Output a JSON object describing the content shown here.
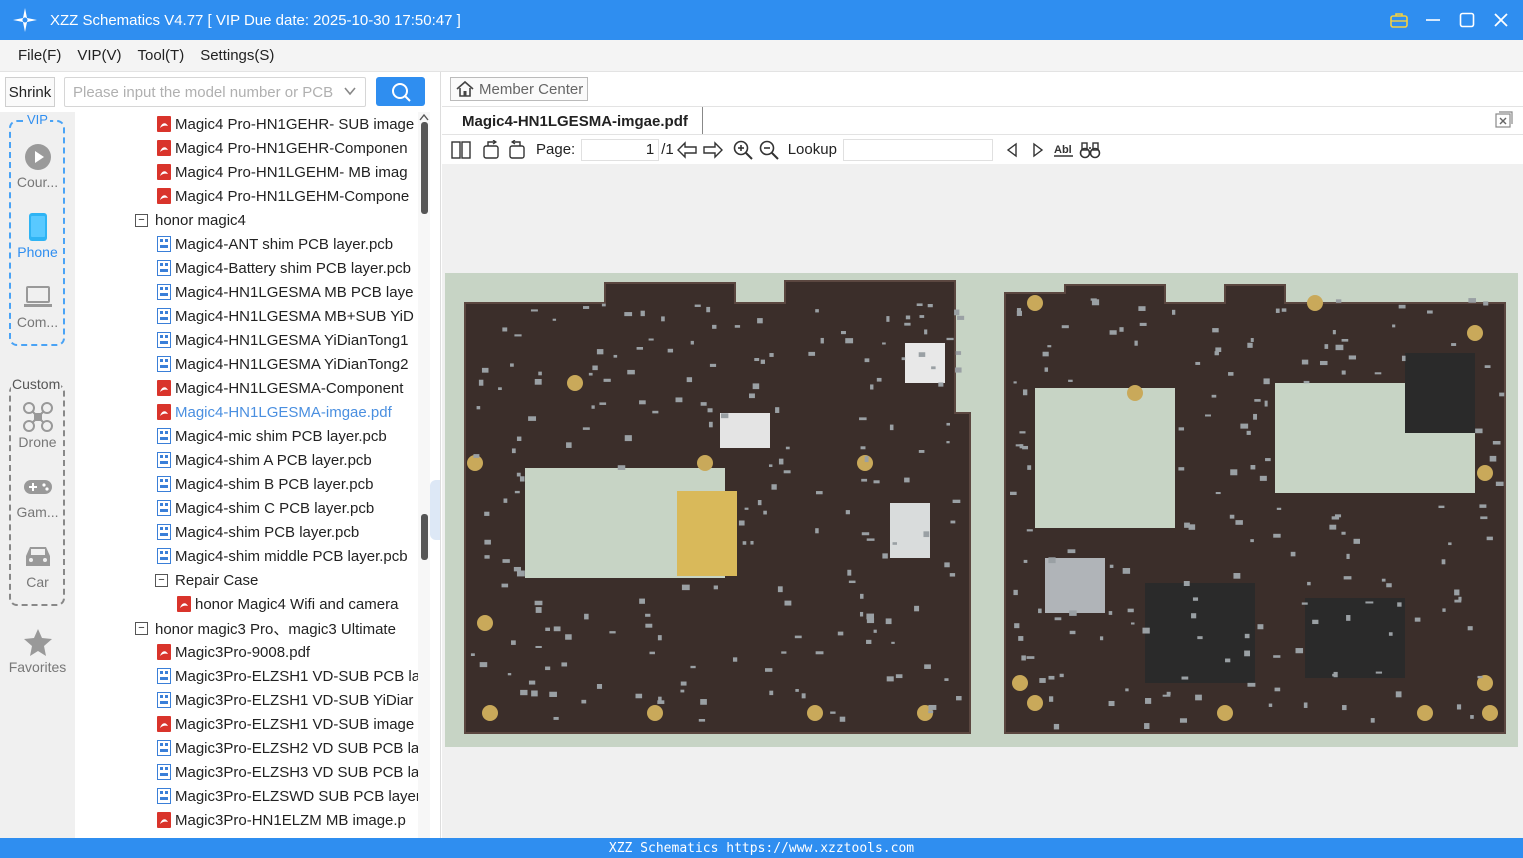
{
  "window": {
    "title": "XZZ Schematics V4.77 [ VIP Due date: 2025-10-30 17:50:47 ]"
  },
  "menu": [
    "File(F)",
    "VIP(V)",
    "Tool(T)",
    "Settings(S)"
  ],
  "search": {
    "shrink_label": "Shrink",
    "placeholder": "Please input the model number or PCB"
  },
  "categories": {
    "vip_label": "VIP",
    "custom_label": "Custom",
    "items": [
      {
        "label": "Cour...",
        "icon": "play-circle-icon"
      },
      {
        "label": "Phone",
        "icon": "phone-icon"
      },
      {
        "label": "Com...",
        "icon": "laptop-icon"
      },
      {
        "label": "Drone",
        "icon": "drone-icon"
      },
      {
        "label": "Gam...",
        "icon": "gamepad-icon"
      },
      {
        "label": "Car",
        "icon": "car-icon"
      },
      {
        "label": "Favorites",
        "icon": "star-icon"
      }
    ]
  },
  "tree": [
    {
      "label": "Magic4 Pro-HN1GEHR- SUB image",
      "type": "pdf"
    },
    {
      "label": "Magic4 Pro-HN1GEHR-Componen",
      "type": "pdf"
    },
    {
      "label": "Magic4 Pro-HN1LGEHM- MB imag",
      "type": "pdf"
    },
    {
      "label": "Magic4 Pro-HN1LGEHM-Compone",
      "type": "pdf"
    },
    {
      "label": "honor magic4",
      "type": "folder"
    },
    {
      "label": "Magic4-ANT shim PCB layer.pcb",
      "type": "pcb"
    },
    {
      "label": "Magic4-Battery shim PCB layer.pcb",
      "type": "pcb"
    },
    {
      "label": "Magic4-HN1LGESMA MB PCB laye",
      "type": "pcb"
    },
    {
      "label": "Magic4-HN1LGESMA MB+SUB YiD",
      "type": "pcb"
    },
    {
      "label": "Magic4-HN1LGESMA YiDianTong1",
      "type": "pcb"
    },
    {
      "label": "Magic4-HN1LGESMA YiDianTong2",
      "type": "pcb"
    },
    {
      "label": "Magic4-HN1LGESMA-Component",
      "type": "pdf"
    },
    {
      "label": "Magic4-HN1LGESMA-imgae.pdf",
      "type": "pdf"
    },
    {
      "label": "Magic4-mic shim PCB layer.pcb",
      "type": "pcb"
    },
    {
      "label": "Magic4-shim A PCB layer.pcb",
      "type": "pcb"
    },
    {
      "label": "Magic4-shim B PCB layer.pcb",
      "type": "pcb"
    },
    {
      "label": "Magic4-shim C PCB layer.pcb",
      "type": "pcb"
    },
    {
      "label": "Magic4-shim PCB layer.pcb",
      "type": "pcb"
    },
    {
      "label": "Magic4-shim middle PCB layer.pcb",
      "type": "pcb"
    },
    {
      "label": "Repair Case",
      "type": "folder"
    },
    {
      "label": "honor Magic4 Wifi and camera",
      "type": "pdf"
    },
    {
      "label": "honor magic3 Pro、magic3 Ultimate",
      "type": "folder"
    },
    {
      "label": "Magic3Pro-9008.pdf",
      "type": "pdf"
    },
    {
      "label": "Magic3Pro-ELZSH1 VD-SUB PCB la",
      "type": "pcb"
    },
    {
      "label": "Magic3Pro-ELZSH1 VD-SUB YiDiar",
      "type": "pcb"
    },
    {
      "label": "Magic3Pro-ELZSH1 VD-SUB image",
      "type": "pdf"
    },
    {
      "label": "Magic3Pro-ELZSH2 VD SUB PCB la",
      "type": "pcb"
    },
    {
      "label": "Magic3Pro-ELZSH3 VD SUB PCB la",
      "type": "pcb"
    },
    {
      "label": "Magic3Pro-ELZSWD SUB PCB layer",
      "type": "pcb"
    },
    {
      "label": "Magic3Pro-HN1ELZM MB image.p",
      "type": "pdf"
    }
  ],
  "viewer": {
    "member_center": "Member Center",
    "tab": "Magic4-HN1LGESMA-imgae.pdf",
    "page_label": "Page:",
    "page_current": "1",
    "page_total": "/1",
    "lookup_label": "Lookup",
    "lookup_value": ""
  },
  "status": {
    "text": "XZZ Schematics https://www.xzztools.com"
  },
  "colors": {
    "accent": "#2f8ef0",
    "pdf": "#d9342b",
    "pcb": "#3a7fd8",
    "board": "#3b2e2a"
  }
}
